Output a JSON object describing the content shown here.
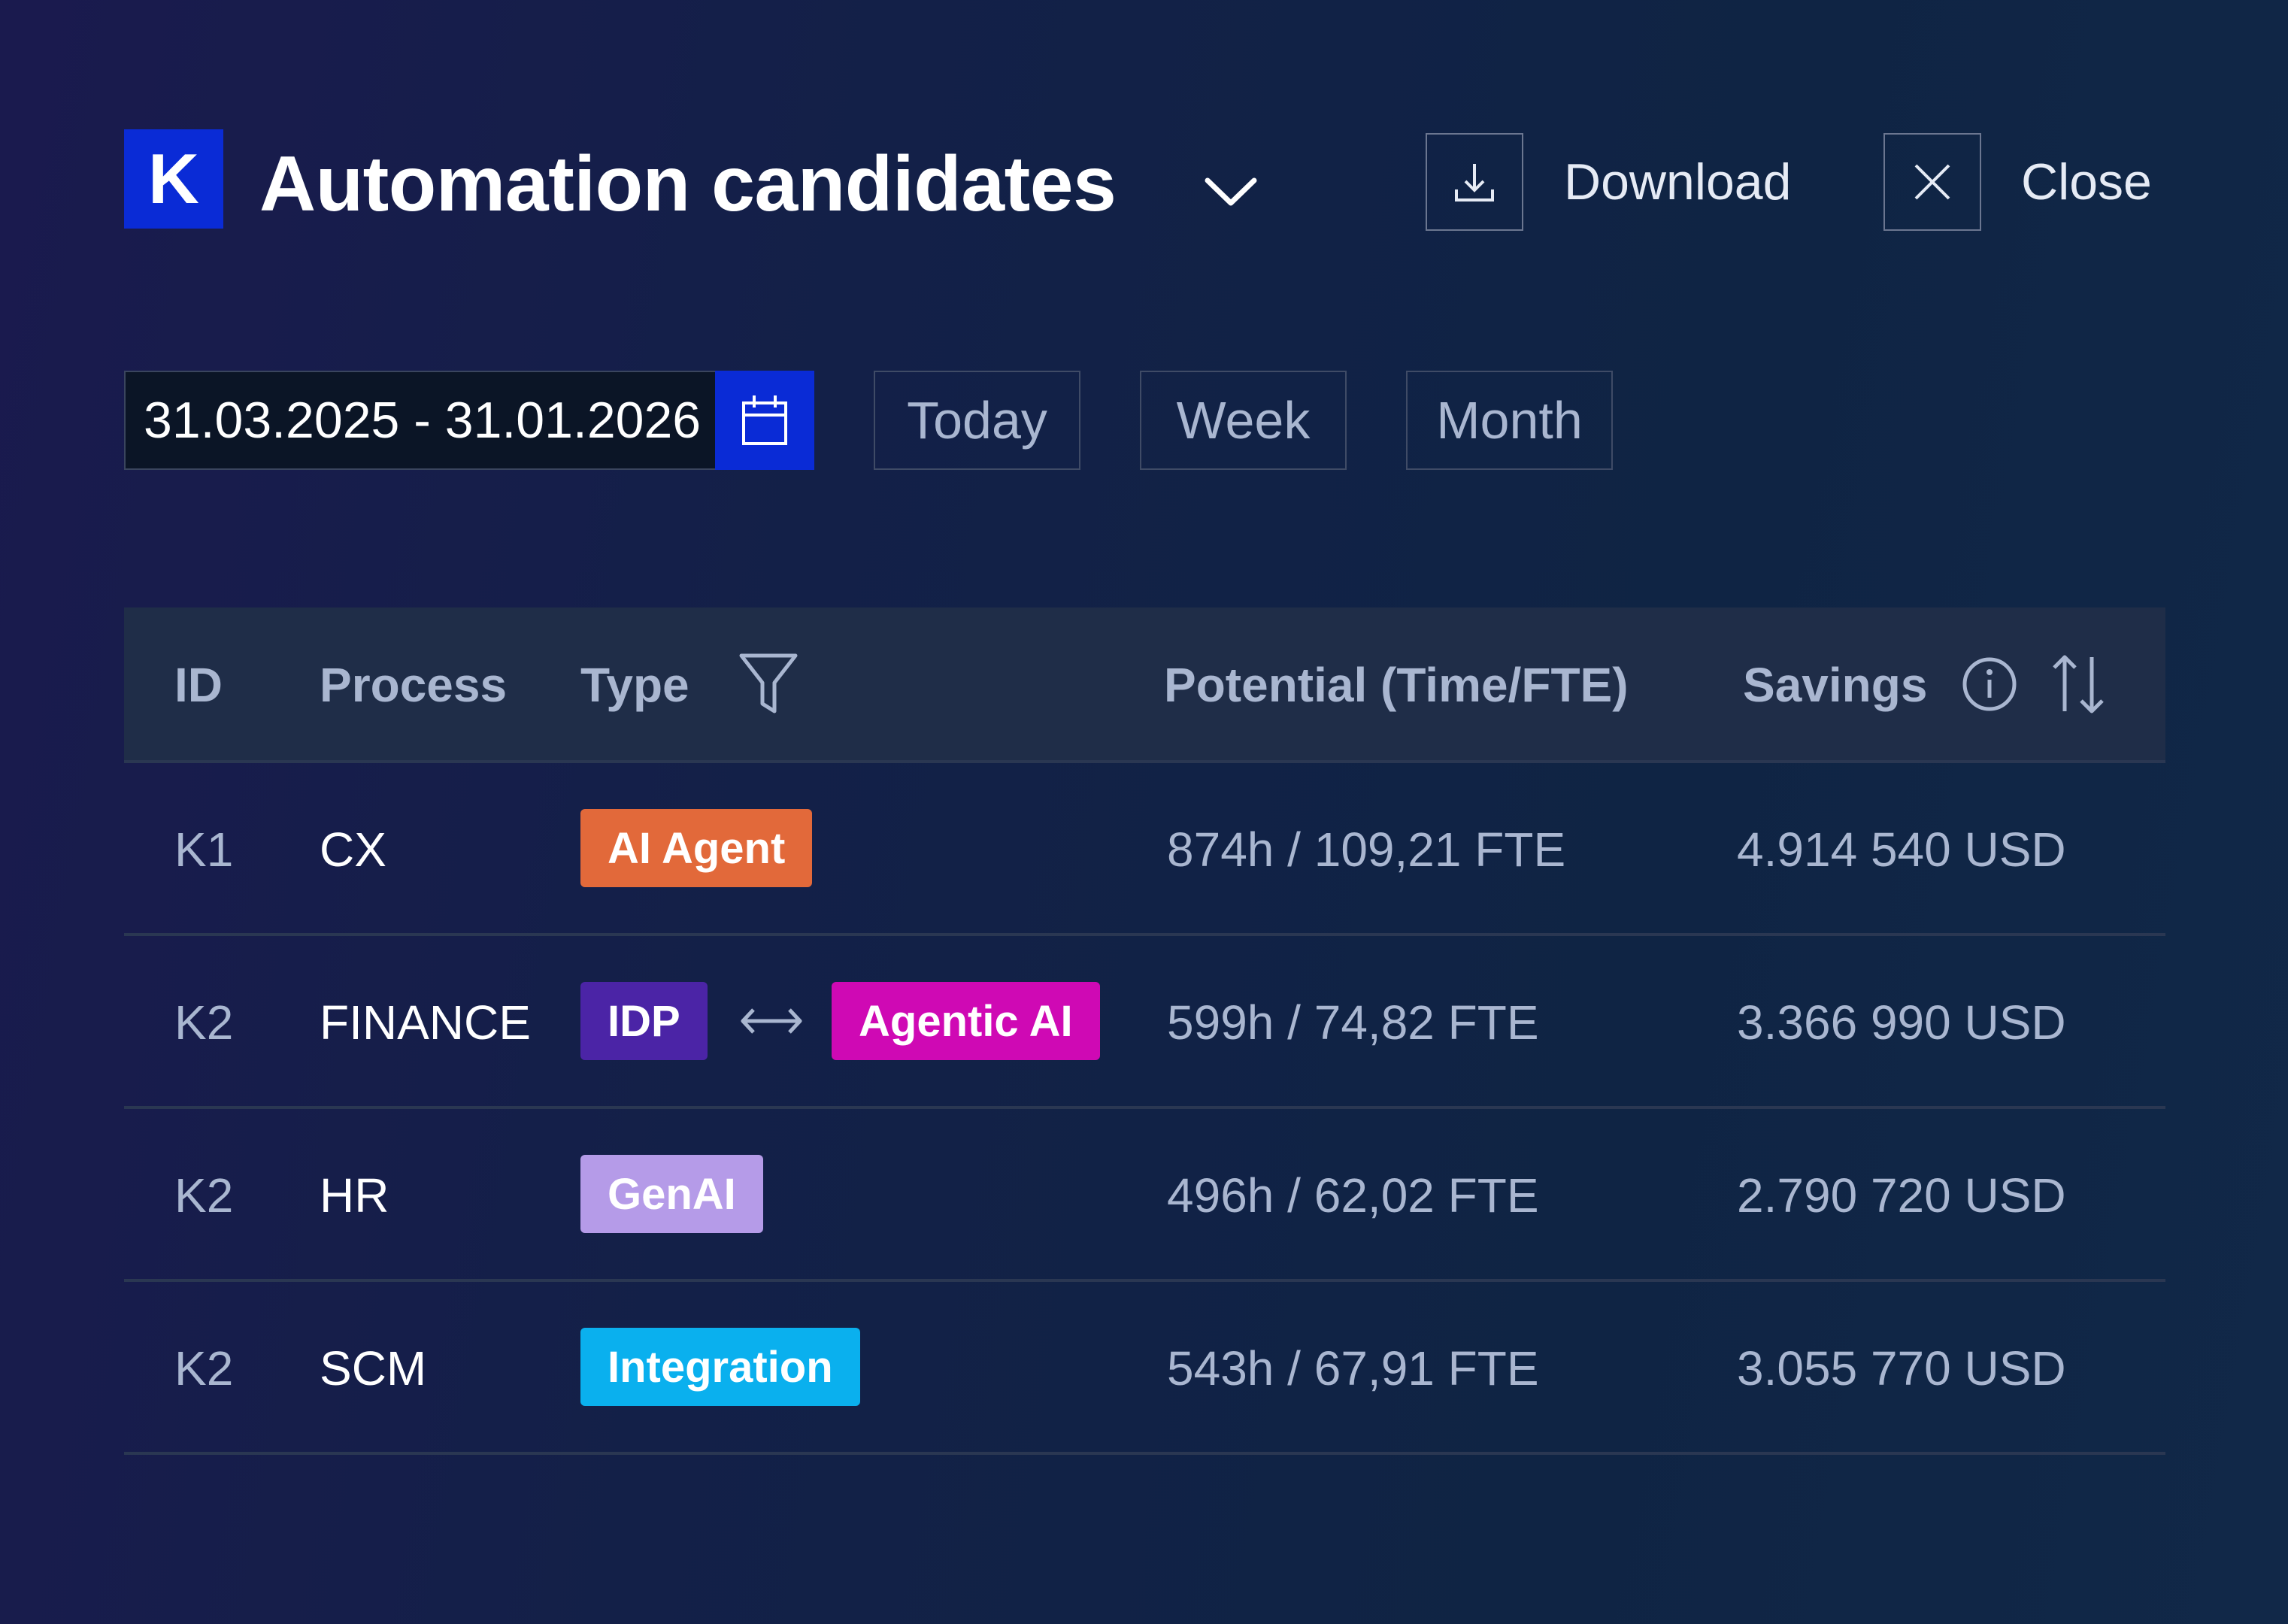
{
  "header": {
    "logo_letter": "K",
    "title": "Automation candidates",
    "download_label": "Download",
    "close_label": "Close"
  },
  "date_filter": {
    "range_value": "31.03.2025 - 31.01.2026",
    "quick_ranges": [
      "Today",
      "Week",
      "Month"
    ]
  },
  "table": {
    "columns": [
      "ID",
      "Process",
      "Type",
      "Potential (Time/FTE)",
      "Savings"
    ],
    "rows": [
      {
        "id": "K1",
        "process": "CX",
        "types": [
          "AI Agent"
        ],
        "potential": "874h / 109,21 FTE",
        "savings": "4.914 540 USD"
      },
      {
        "id": "K2",
        "process": "FINANCE",
        "types": [
          "IDP",
          "Agentic AI"
        ],
        "potential": "599h / 74,82 FTE",
        "savings": "3.366 990 USD"
      },
      {
        "id": "K2",
        "process": "HR",
        "types": [
          "GenAI"
        ],
        "potential": "496h / 62,02 FTE",
        "savings": "2.790 720 USD"
      },
      {
        "id": "K2",
        "process": "SCM",
        "types": [
          "Integration"
        ],
        "potential": "543h / 67,91 FTE",
        "savings": "3.055 770 USD"
      }
    ]
  },
  "colors": {
    "accent_blue": "#0a2bd6",
    "tag_ai_agent": "#e2693a",
    "tag_idp": "#4b24a6",
    "tag_agentic_ai": "#cf09b4",
    "tag_genai": "#b59be8",
    "tag_integration": "#0ab0ee"
  },
  "icons": [
    "chevron-down-icon",
    "download-icon",
    "close-icon",
    "calendar-icon",
    "filter-icon",
    "info-icon",
    "sort-icon",
    "bidirectional-arrow-icon"
  ]
}
